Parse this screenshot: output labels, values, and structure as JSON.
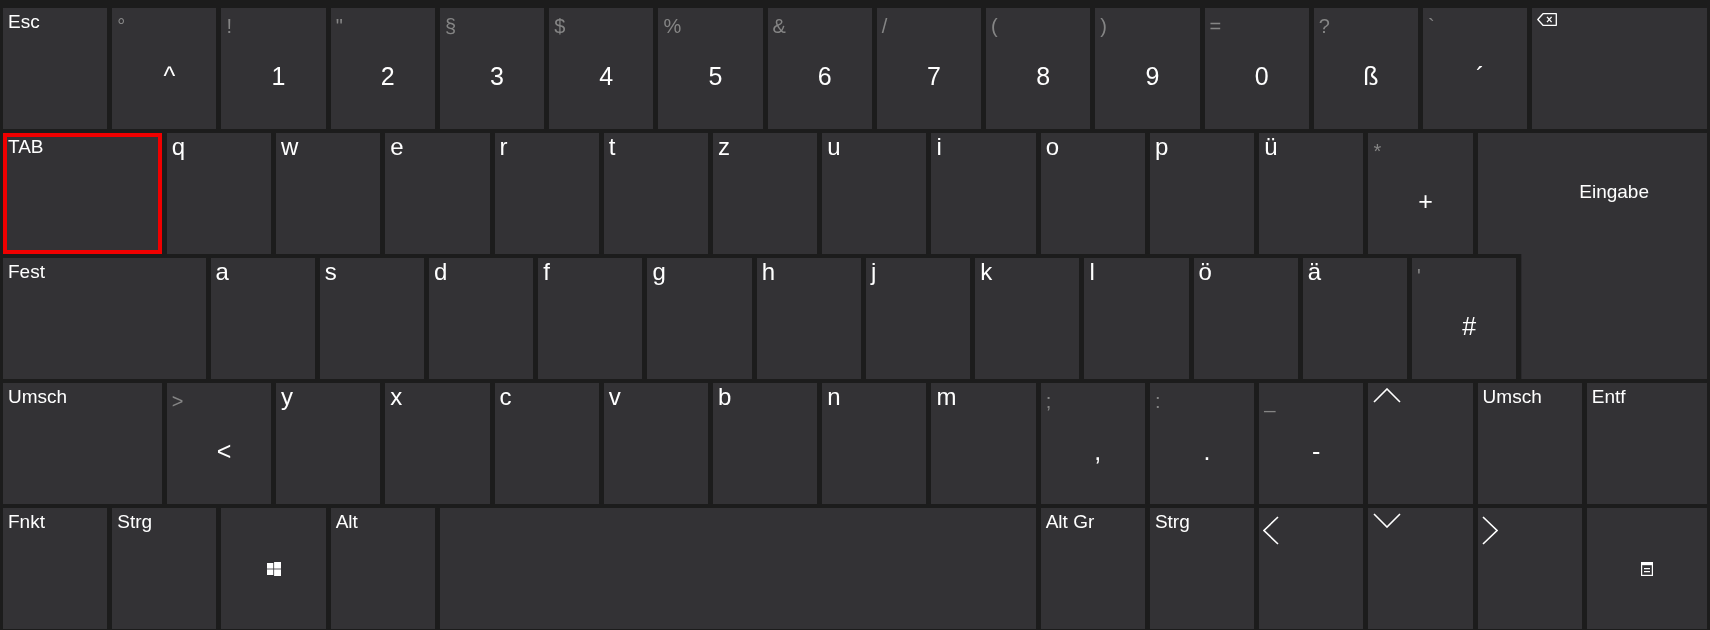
{
  "keyboard": {
    "rows": [
      {
        "keys": [
          {
            "kind": "label",
            "label": "Esc",
            "highlighted": false
          },
          {
            "kind": "symbol",
            "shift": "°",
            "main": "^",
            "highlighted": false
          },
          {
            "kind": "symbol",
            "shift": "!",
            "main": "1",
            "highlighted": false
          },
          {
            "kind": "symbol",
            "shift": "\"",
            "main": "2",
            "highlighted": false
          },
          {
            "kind": "symbol",
            "shift": "§",
            "main": "3",
            "highlighted": false
          },
          {
            "kind": "symbol",
            "shift": "$",
            "main": "4",
            "highlighted": false
          },
          {
            "kind": "symbol",
            "shift": "%",
            "main": "5",
            "highlighted": false
          },
          {
            "kind": "symbol",
            "shift": "&",
            "main": "6",
            "highlighted": false
          },
          {
            "kind": "symbol",
            "shift": "/",
            "main": "7",
            "highlighted": false
          },
          {
            "kind": "symbol",
            "shift": "(",
            "main": "8",
            "highlighted": false
          },
          {
            "kind": "symbol",
            "shift": ")",
            "main": "9",
            "highlighted": false
          },
          {
            "kind": "symbol",
            "shift": "=",
            "main": "0",
            "highlighted": false
          },
          {
            "kind": "symbol",
            "shift": "?",
            "main": "ß",
            "highlighted": false
          },
          {
            "kind": "symbol",
            "shift": "`",
            "main": "´",
            "highlighted": false
          },
          {
            "kind": "backspace",
            "highlighted": false
          }
        ]
      },
      {
        "keys": [
          {
            "kind": "label",
            "label": "TAB",
            "highlighted": true
          },
          {
            "kind": "letter",
            "label": "q",
            "highlighted": false
          },
          {
            "kind": "letter",
            "label": "w",
            "highlighted": false
          },
          {
            "kind": "letter",
            "label": "e",
            "highlighted": false
          },
          {
            "kind": "letter",
            "label": "r",
            "highlighted": false
          },
          {
            "kind": "letter",
            "label": "t",
            "highlighted": false
          },
          {
            "kind": "letter",
            "label": "z",
            "highlighted": false
          },
          {
            "kind": "letter",
            "label": "u",
            "highlighted": false
          },
          {
            "kind": "letter",
            "label": "i",
            "highlighted": false
          },
          {
            "kind": "letter",
            "label": "o",
            "highlighted": false
          },
          {
            "kind": "letter",
            "label": "p",
            "highlighted": false
          },
          {
            "kind": "letter",
            "label": "ü",
            "highlighted": false
          },
          {
            "kind": "symbol",
            "shift": "*",
            "main": "+",
            "highlighted": false
          },
          {
            "kind": "enter",
            "label": "Eingabe",
            "highlighted": false
          }
        ]
      },
      {
        "keys": [
          {
            "kind": "label",
            "label": "Fest",
            "highlighted": false
          },
          {
            "kind": "letter",
            "label": "a",
            "highlighted": false
          },
          {
            "kind": "letter",
            "label": "s",
            "highlighted": false
          },
          {
            "kind": "letter",
            "label": "d",
            "highlighted": false
          },
          {
            "kind": "letter",
            "label": "f",
            "highlighted": false
          },
          {
            "kind": "letter",
            "label": "g",
            "highlighted": false
          },
          {
            "kind": "letter",
            "label": "h",
            "highlighted": false
          },
          {
            "kind": "letter",
            "label": "j",
            "highlighted": false
          },
          {
            "kind": "letter",
            "label": "k",
            "highlighted": false
          },
          {
            "kind": "letter",
            "label": "l",
            "highlighted": false
          },
          {
            "kind": "letter",
            "label": "ö",
            "highlighted": false
          },
          {
            "kind": "letter",
            "label": "ä",
            "highlighted": false
          },
          {
            "kind": "symbol",
            "shift": "'",
            "main": "#",
            "highlighted": false
          }
        ]
      },
      {
        "keys": [
          {
            "kind": "label",
            "label": "Umsch",
            "highlighted": false
          },
          {
            "kind": "symbol",
            "shift": ">",
            "main": "<",
            "highlighted": false
          },
          {
            "kind": "letter",
            "label": "y",
            "highlighted": false
          },
          {
            "kind": "letter",
            "label": "x",
            "highlighted": false
          },
          {
            "kind": "letter",
            "label": "c",
            "highlighted": false
          },
          {
            "kind": "letter",
            "label": "v",
            "highlighted": false
          },
          {
            "kind": "letter",
            "label": "b",
            "highlighted": false
          },
          {
            "kind": "letter",
            "label": "n",
            "highlighted": false
          },
          {
            "kind": "letter",
            "label": "m",
            "highlighted": false
          },
          {
            "kind": "symbol",
            "shift": ";",
            "main": ",",
            "highlighted": false
          },
          {
            "kind": "symbol",
            "shift": ":",
            "main": ".",
            "highlighted": false
          },
          {
            "kind": "symbol",
            "shift": "_",
            "main": "-",
            "highlighted": false
          },
          {
            "kind": "up",
            "highlighted": false
          },
          {
            "kind": "label",
            "label": "Umsch",
            "highlighted": false
          },
          {
            "kind": "label",
            "label": "Entf",
            "highlighted": false
          }
        ]
      },
      {
        "keys": [
          {
            "kind": "label",
            "label": "Fnkt",
            "highlighted": false
          },
          {
            "kind": "label",
            "label": "Strg",
            "highlighted": false
          },
          {
            "kind": "windows",
            "highlighted": false
          },
          {
            "kind": "label",
            "label": "Alt",
            "highlighted": false
          },
          {
            "kind": "space",
            "highlighted": false
          },
          {
            "kind": "label",
            "label": "Alt Gr",
            "highlighted": false
          },
          {
            "kind": "label",
            "label": "Strg",
            "highlighted": false
          },
          {
            "kind": "left",
            "highlighted": false
          },
          {
            "kind": "down",
            "highlighted": false
          },
          {
            "kind": "right",
            "highlighted": false
          },
          {
            "kind": "menu",
            "highlighted": false
          }
        ]
      }
    ]
  }
}
